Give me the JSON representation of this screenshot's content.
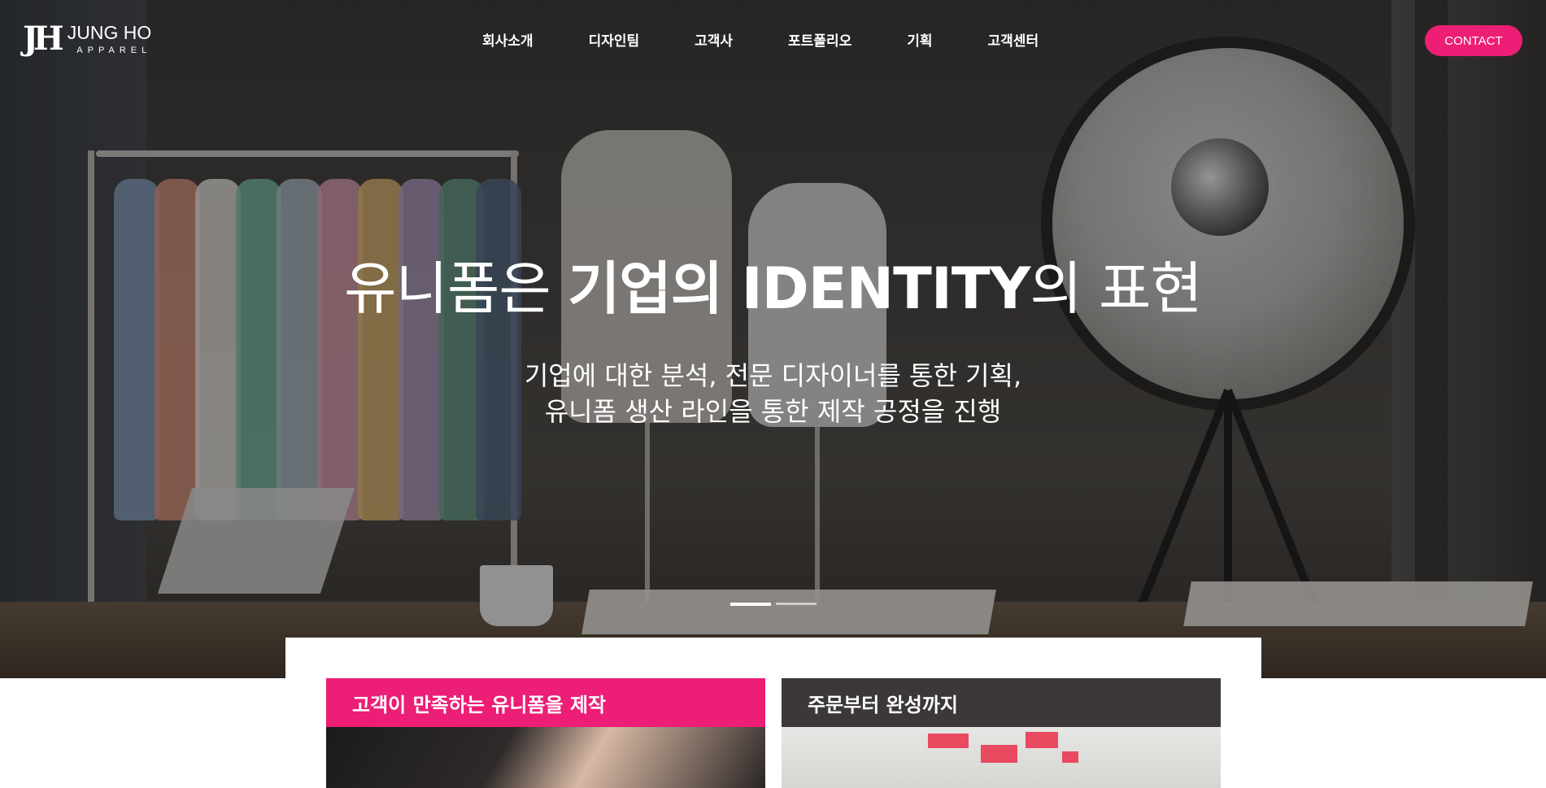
{
  "brand": {
    "mark": "JH",
    "name": "JUNG HO",
    "sub": "APPAREL"
  },
  "nav": {
    "items": [
      {
        "label": "회사소개"
      },
      {
        "label": "디자인팀"
      },
      {
        "label": "고객사"
      },
      {
        "label": "포트폴리오"
      },
      {
        "label": "기획"
      },
      {
        "label": "고객센터"
      }
    ]
  },
  "contact": {
    "label": "CONTACT"
  },
  "hero": {
    "headline_pre": "유니폼은 ",
    "headline_bold": "기업의 IDENTITY",
    "headline_post": "의 표현",
    "sub_line1": "기업에 대한 분석, 전문 디자이너를 통한 기획,",
    "sub_line2": "유니폼 생산 라인을 통한 제작 공정을 진행",
    "slides_total": 2,
    "active_slide": 1
  },
  "cards": [
    {
      "title": "고객이 만족하는 유니폼을 제작"
    },
    {
      "title": "주문부터 완성까지"
    }
  ],
  "colors": {
    "accent": "#ec1e75",
    "dark_card": "#3c3838",
    "text_on_dark": "#ffffff"
  }
}
